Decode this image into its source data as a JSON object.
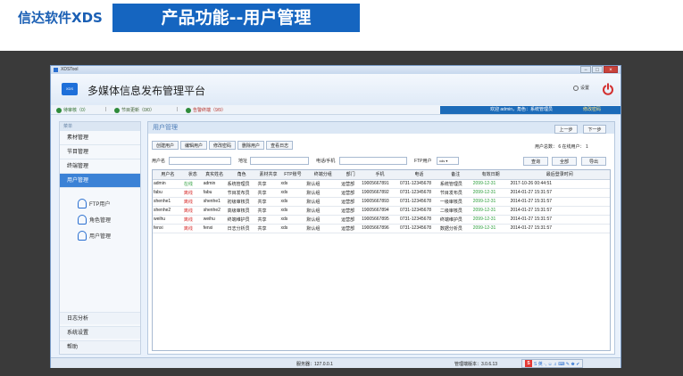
{
  "slide": {
    "brand": "信达软件XDS",
    "title": "产品功能--用户管理"
  },
  "window": {
    "title": "XDSTool",
    "controls": [
      "−",
      "□",
      "×"
    ]
  },
  "app": {
    "logo_text": "XDS",
    "title": "多媒体信息发布管理平台",
    "settings_label": "设置"
  },
  "status": {
    "items": [
      {
        "label": "待审核（0）"
      },
      {
        "label": "节目更新（0/0）"
      },
      {
        "label": "告警终端（9/9）"
      }
    ],
    "separator": "|",
    "user_info": "欢迎 admin，角色：系统管理员",
    "change_password": "修改密码"
  },
  "sidebar": {
    "header": "菜单",
    "items": [
      "素材管理",
      "节目管理",
      "终端管理",
      "用户管理"
    ],
    "subitems": [
      "FTP用户",
      "角色管理",
      "用户管理"
    ],
    "bottom_items": [
      "日志分析",
      "系统设置",
      "帮助"
    ]
  },
  "panel": {
    "title": "用户管理",
    "prev": "上一步",
    "next": "下一步",
    "toolbar": [
      "创建用户",
      "编辑用户",
      "修改密码",
      "删除用户",
      "查看日志"
    ],
    "counts": "用户总数：  6  在线用户：  1",
    "filters": {
      "username_label": "用户名",
      "address_label": "地址",
      "phone_label": "电话/手机",
      "ftp_label": "FTP用户",
      "ftp_value": "xds ▾"
    },
    "buttons": {
      "search": "查询",
      "all": "全部",
      "export": "导出"
    }
  },
  "table": {
    "columns": [
      "用户名",
      "状态",
      "真实姓名",
      "角色",
      "素材共享",
      "FTP账号",
      "终端分组",
      "部门",
      "手机",
      "电话",
      "备注",
      "有效日期",
      "最后登录时间"
    ],
    "rows": [
      [
        "admin",
        "在线",
        "admin",
        "系统管理员",
        "共享",
        "xds",
        "默认组",
        "运营部",
        "19005667891",
        "0731-12345678",
        "系统管理员",
        "2099-12-31",
        "2017-10-26 00:44:51"
      ],
      [
        "fabu",
        "离线",
        "fabu",
        "节目发布员",
        "共享",
        "xds",
        "默认组",
        "运营部",
        "19005667892",
        "0731-12345678",
        "节目发布员",
        "2099-12-31",
        "2014-01-27 15:31:57"
      ],
      [
        "shenhe1",
        "离线",
        "shenhe1",
        "初级审核员",
        "共享",
        "xds",
        "默认组",
        "运营部",
        "19005667893",
        "0731-12345678",
        "一级审核员",
        "2099-12-31",
        "2014-01-27 15:31:57"
      ],
      [
        "shenhe2",
        "离线",
        "shenhe2",
        "高级审核员",
        "共享",
        "xds",
        "默认组",
        "运营部",
        "19005667894",
        "0731-12345678",
        "二级审核员",
        "2099-12-31",
        "2014-01-27 15:31:57"
      ],
      [
        "weihu",
        "离线",
        "weihu",
        "终端维护员",
        "共享",
        "xds",
        "默认组",
        "运营部",
        "19005667895",
        "0731-12345678",
        "终端维护员",
        "2099-12-31",
        "2014-01-27 15:31:57"
      ],
      [
        "fenxi",
        "离线",
        "fenxi",
        "日志分析员",
        "共享",
        "xds",
        "默认组",
        "运营部",
        "19005667896",
        "0731-12345678",
        "数据分析员",
        "2099-12-31",
        "2014-01-27 15:31:57"
      ]
    ]
  },
  "footer": {
    "server": "服务器：127.0.0.1",
    "version": "管理端版本：3.0.6.13",
    "tray": "S 英 ·, ☺ ♫ ⌨ ✎ ♚ ✔"
  },
  "colors": {
    "accent": "#1565c0",
    "online": "#2a9d3a",
    "offline": "#d62a2a",
    "power": "#d32f2f"
  }
}
